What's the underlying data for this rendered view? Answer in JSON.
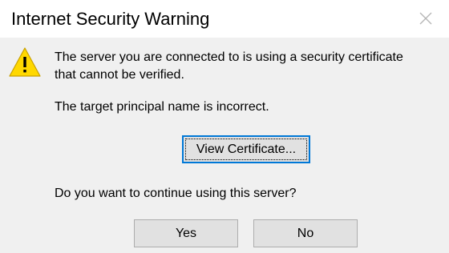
{
  "window": {
    "title": "Internet Security Warning",
    "close_icon": "close-icon"
  },
  "message": {
    "line1": "The server you are connected to is using a security certificate",
    "line2": "that cannot be verified.",
    "detail": "The target principal name is incorrect.",
    "question": "Do you want to continue using this server?",
    "icon": "warning-icon"
  },
  "buttons": {
    "view_certificate": "View Certificate...",
    "yes": "Yes",
    "no": "No"
  },
  "colors": {
    "titlebar_bg": "#ffffff",
    "dialog_bg": "#f0f0f0",
    "button_bg": "#e1e1e1",
    "focus_border": "#0078d7",
    "warning_fill": "#ffd800"
  }
}
